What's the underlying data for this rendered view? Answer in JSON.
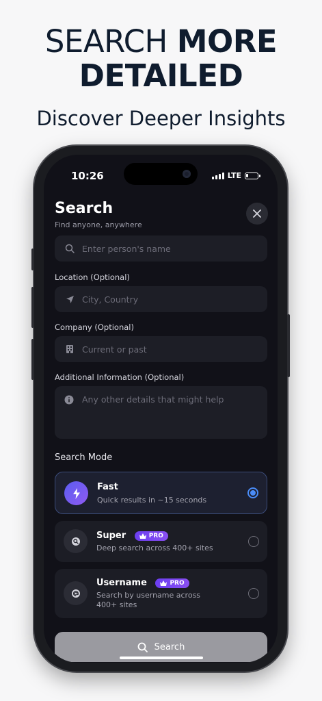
{
  "headline": {
    "line1_light": "SEARCH",
    "line1_bold": "MORE",
    "line2": "DETAILED"
  },
  "subheadline": "Discover Deeper Insights",
  "status_bar": {
    "time": "10:26",
    "network": "LTE"
  },
  "screen": {
    "title": "Search",
    "subtitle": "Find anyone, anywhere",
    "name_field": {
      "placeholder": "Enter person's name",
      "icon": "search-icon"
    },
    "location": {
      "label": "Location (Optional)",
      "placeholder": "City, Country",
      "icon": "location-arrow-icon"
    },
    "company": {
      "label": "Company (Optional)",
      "placeholder": "Current or past",
      "icon": "building-icon"
    },
    "additional": {
      "label": "Additional Information (Optional)",
      "placeholder": "Any other details that might help",
      "icon": "info-icon"
    },
    "search_mode_title": "Search Mode",
    "modes": [
      {
        "name": "Fast",
        "description": "Quick results in ~15 seconds",
        "selected": true,
        "icon": "lightning-icon"
      },
      {
        "name": "Super",
        "badge": "PRO",
        "description": "Deep search across 400+ sites",
        "selected": false,
        "icon": "search-icon"
      },
      {
        "name": "Username",
        "badge": "PRO",
        "description": "Search by username across 400+ sites",
        "selected": false,
        "icon": "at-icon"
      }
    ],
    "search_button": "Search"
  },
  "colors": {
    "accent": "#4a8cf7",
    "pro_badge": "#7b46f2",
    "background": "#111118"
  }
}
